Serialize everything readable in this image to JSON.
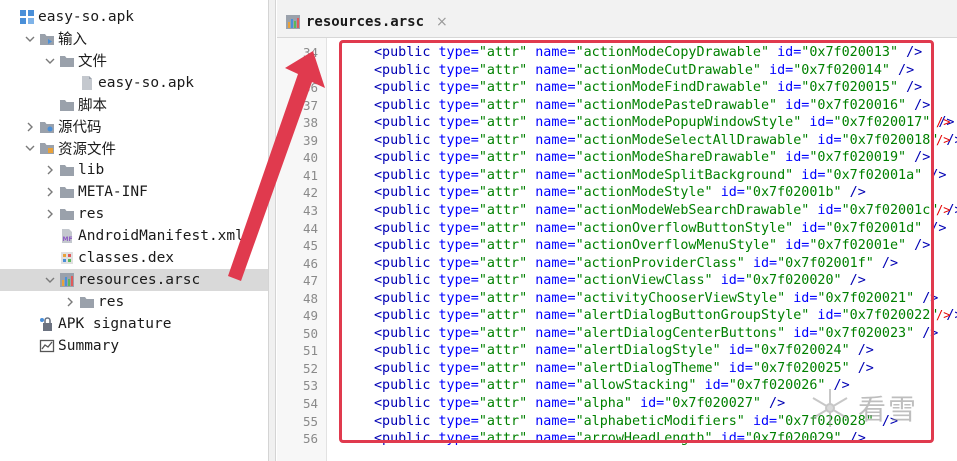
{
  "tree": {
    "items": [
      {
        "label": "easy-so.apk",
        "icon": "apk-project-icon",
        "chevron": "none",
        "indent": 0
      },
      {
        "label": "输入",
        "icon": "input-folder-icon",
        "chevron": "down",
        "indent": 1
      },
      {
        "label": "文件",
        "icon": "folder-icon",
        "chevron": "down",
        "indent": 2
      },
      {
        "label": "easy-so.apk",
        "icon": "file-icon",
        "chevron": "none",
        "indent": 3
      },
      {
        "label": "脚本",
        "icon": "folder-icon",
        "chevron": "none",
        "indent": 2
      },
      {
        "label": "源代码",
        "icon": "source-folder-icon",
        "chevron": "right",
        "indent": 1
      },
      {
        "label": "资源文件",
        "icon": "resources-folder-icon",
        "chevron": "down",
        "indent": 1
      },
      {
        "label": "lib",
        "icon": "folder-icon",
        "chevron": "right",
        "indent": 2
      },
      {
        "label": "META-INF",
        "icon": "folder-icon",
        "chevron": "right",
        "indent": 2
      },
      {
        "label": "res",
        "icon": "folder-icon",
        "chevron": "right",
        "indent": 2
      },
      {
        "label": "AndroidManifest.xml",
        "icon": "manifest-icon",
        "chevron": "none",
        "indent": 2
      },
      {
        "label": "classes.dex",
        "icon": "dex-icon",
        "chevron": "none",
        "indent": 2
      },
      {
        "label": "resources.arsc",
        "icon": "arsc-icon",
        "chevron": "down",
        "indent": 2,
        "selected": true
      },
      {
        "label": "res",
        "icon": "folder-icon",
        "chevron": "right",
        "indent": 3
      },
      {
        "label": "APK signature",
        "icon": "signature-icon",
        "chevron": "none",
        "indent": 1
      },
      {
        "label": "Summary",
        "icon": "summary-icon",
        "chevron": "none",
        "indent": 1
      }
    ]
  },
  "editor": {
    "tab": {
      "label": "resources.arsc",
      "close": "×"
    },
    "lines": [
      {
        "n": "34",
        "name": "actionModeCopyDrawable",
        "id": "0x7f020013",
        "tail": " />"
      },
      {
        "n": "35",
        "name": "actionModeCutDrawable",
        "id": "0x7f020014",
        "tail": " />"
      },
      {
        "n": "36",
        "name": "actionModeFindDrawable",
        "id": "0x7f020015",
        "tail": " />"
      },
      {
        "n": "37",
        "name": "actionModePasteDrawable",
        "id": "0x7f020016",
        "tail": " />"
      },
      {
        "n": "38",
        "name": "actionModePopupWindowStyle",
        "id": "0x7f020017",
        "tail": " />"
      },
      {
        "n": "39",
        "name": "actionModeSelectAllDrawable",
        "id": "0x7f020018",
        "tail": " />"
      },
      {
        "n": "40",
        "name": "actionModeShareDrawable",
        "id": "0x7f020019",
        "tail": " />"
      },
      {
        "n": "41",
        "name": "actionModeSplitBackground",
        "id": "0x7f02001a",
        "tail": " />"
      },
      {
        "n": "42",
        "name": "actionModeStyle",
        "id": "0x7f02001b",
        "tail": " />"
      },
      {
        "n": "43",
        "name": "actionModeWebSearchDrawable",
        "id": "0x7f02001c",
        "tail": " />"
      },
      {
        "n": "44",
        "name": "actionOverflowButtonStyle",
        "id": "0x7f02001d",
        "tail": " />"
      },
      {
        "n": "45",
        "name": "actionOverflowMenuStyle",
        "id": "0x7f02001e",
        "tail": " />"
      },
      {
        "n": "46",
        "name": "actionProviderClass",
        "id": "0x7f02001f",
        "tail": " />"
      },
      {
        "n": "47",
        "name": "actionViewClass",
        "id": "0x7f020020",
        "tail": " />"
      },
      {
        "n": "48",
        "name": "activityChooserViewStyle",
        "id": "0x7f020021",
        "tail": " />"
      },
      {
        "n": "49",
        "name": "alertDialogButtonGroupStyle",
        "id": "0x7f020022",
        "tail": " />"
      },
      {
        "n": "50",
        "name": "alertDialogCenterButtons",
        "id": "0x7f020023",
        "tail": " />"
      },
      {
        "n": "51",
        "name": "alertDialogStyle",
        "id": "0x7f020024",
        "tail": " />"
      },
      {
        "n": "52",
        "name": "alertDialogTheme",
        "id": "0x7f020025",
        "tail": " />"
      },
      {
        "n": "53",
        "name": "allowStacking",
        "id": "0x7f020026",
        "tail": " />"
      },
      {
        "n": "54",
        "name": "alpha",
        "id": "0x7f020027",
        "tail": " />"
      },
      {
        "n": "55",
        "name": "alphabeticModifiers",
        "id": "0x7f020028",
        "tail": " />"
      },
      {
        "n": "56",
        "name": "arrowHeadLength",
        "id": "0x7f020029",
        "tail": " />"
      }
    ],
    "syntax": {
      "tag": "<public",
      "type_attr": "type=",
      "type_val": "\"attr\"",
      "name_attr": "name=",
      "id_attr": "id="
    },
    "overflow_marker": "/>"
  },
  "watermark": {
    "text": "看雪"
  },
  "colors": {
    "annotation_red": "#e03a4e",
    "selection": "#d9d9d9",
    "xml_tag": "#0000b4",
    "xml_attr": "#0000ff",
    "xml_value": "#008000"
  }
}
